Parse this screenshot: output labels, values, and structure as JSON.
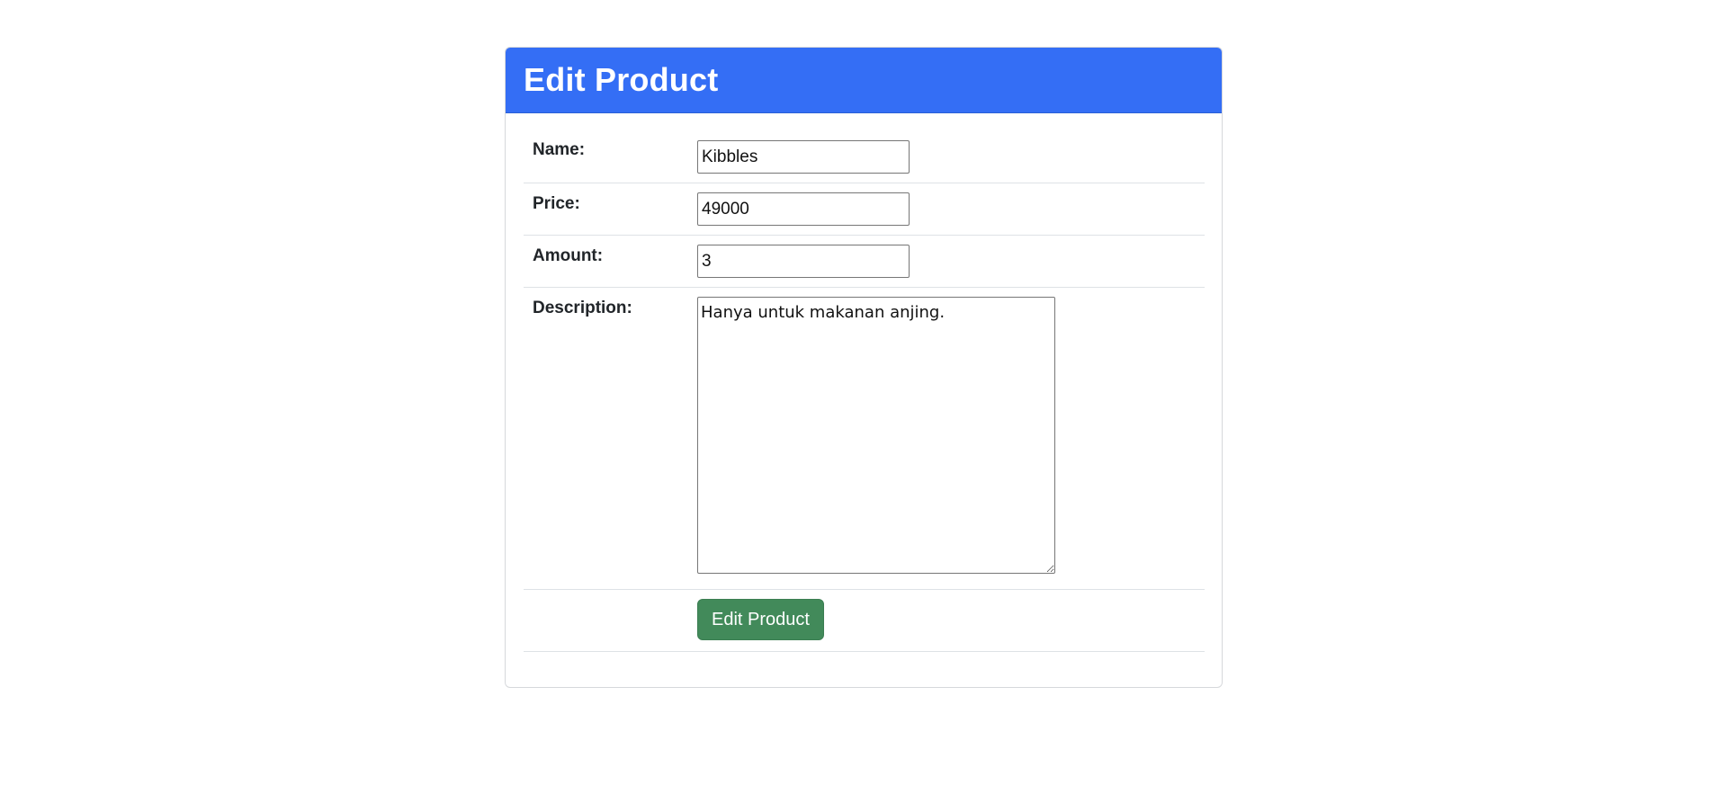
{
  "colors": {
    "header_bg": "#346ef5",
    "submit_bg": "#428a5a",
    "border": "#dee2e6"
  },
  "card": {
    "title": "Edit Product"
  },
  "form": {
    "name": {
      "label": "Name:",
      "value": "Kibbles"
    },
    "price": {
      "label": "Price:",
      "value": "49000"
    },
    "amount": {
      "label": "Amount:",
      "value": "3"
    },
    "description": {
      "label": "Description:",
      "value": "Hanya untuk makanan anjing."
    },
    "submit_label": "Edit Product"
  }
}
